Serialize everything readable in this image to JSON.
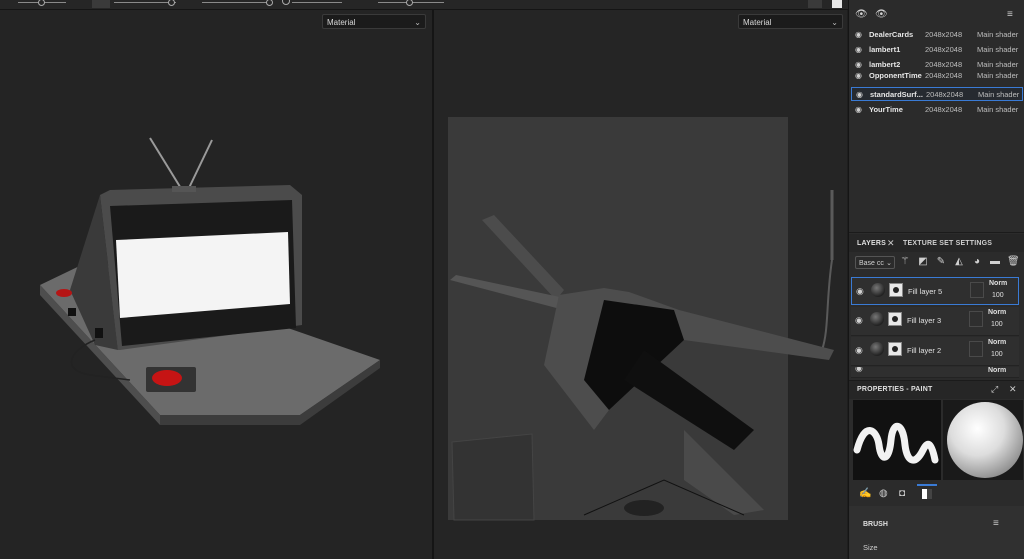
{
  "viewport3d": {
    "dropdown": "Material"
  },
  "viewport2d": {
    "dropdown": "Material"
  },
  "texture_sets": [
    {
      "name": "DealerCards",
      "res": "2048x2048",
      "shader": "Main shader"
    },
    {
      "name": "lambert1",
      "res": "2048x2048",
      "shader": "Main shader"
    },
    {
      "name": "lambert2",
      "res": "2048x2048",
      "shader": "Main shader"
    },
    {
      "name": "OpponentTime",
      "res": "2048x2048",
      "shader": "Main shader"
    },
    {
      "name": "standardSurf...",
      "res": "2048x2048",
      "shader": "Main shader"
    },
    {
      "name": "YourTime",
      "res": "2048x2048",
      "shader": "Main shader"
    }
  ],
  "layers_panel": {
    "tab_layers": "LAYERS",
    "tab_texture_set": "TEXTURE SET SETTINGS",
    "channel_select": "Base cc",
    "layers": [
      {
        "name": "Fill layer 5",
        "blend": "Norm",
        "opacity": "100"
      },
      {
        "name": "Fill layer 3",
        "blend": "Norm",
        "opacity": "100"
      },
      {
        "name": "Fill layer 2",
        "blend": "Norm",
        "opacity": "100"
      },
      {
        "name": "",
        "blend": "Norm",
        "opacity": ""
      }
    ]
  },
  "properties": {
    "title": "PROPERTIES - PAINT",
    "section_brush": "BRUSH",
    "size_label": "Size"
  },
  "icons": [
    "eye-icon",
    "eye-icon",
    "filter-icon",
    "close-icon",
    "wand-icon",
    "brush-icon",
    "fill-icon",
    "palette-icon",
    "folder-icon",
    "trash-icon",
    "expand-icon"
  ]
}
